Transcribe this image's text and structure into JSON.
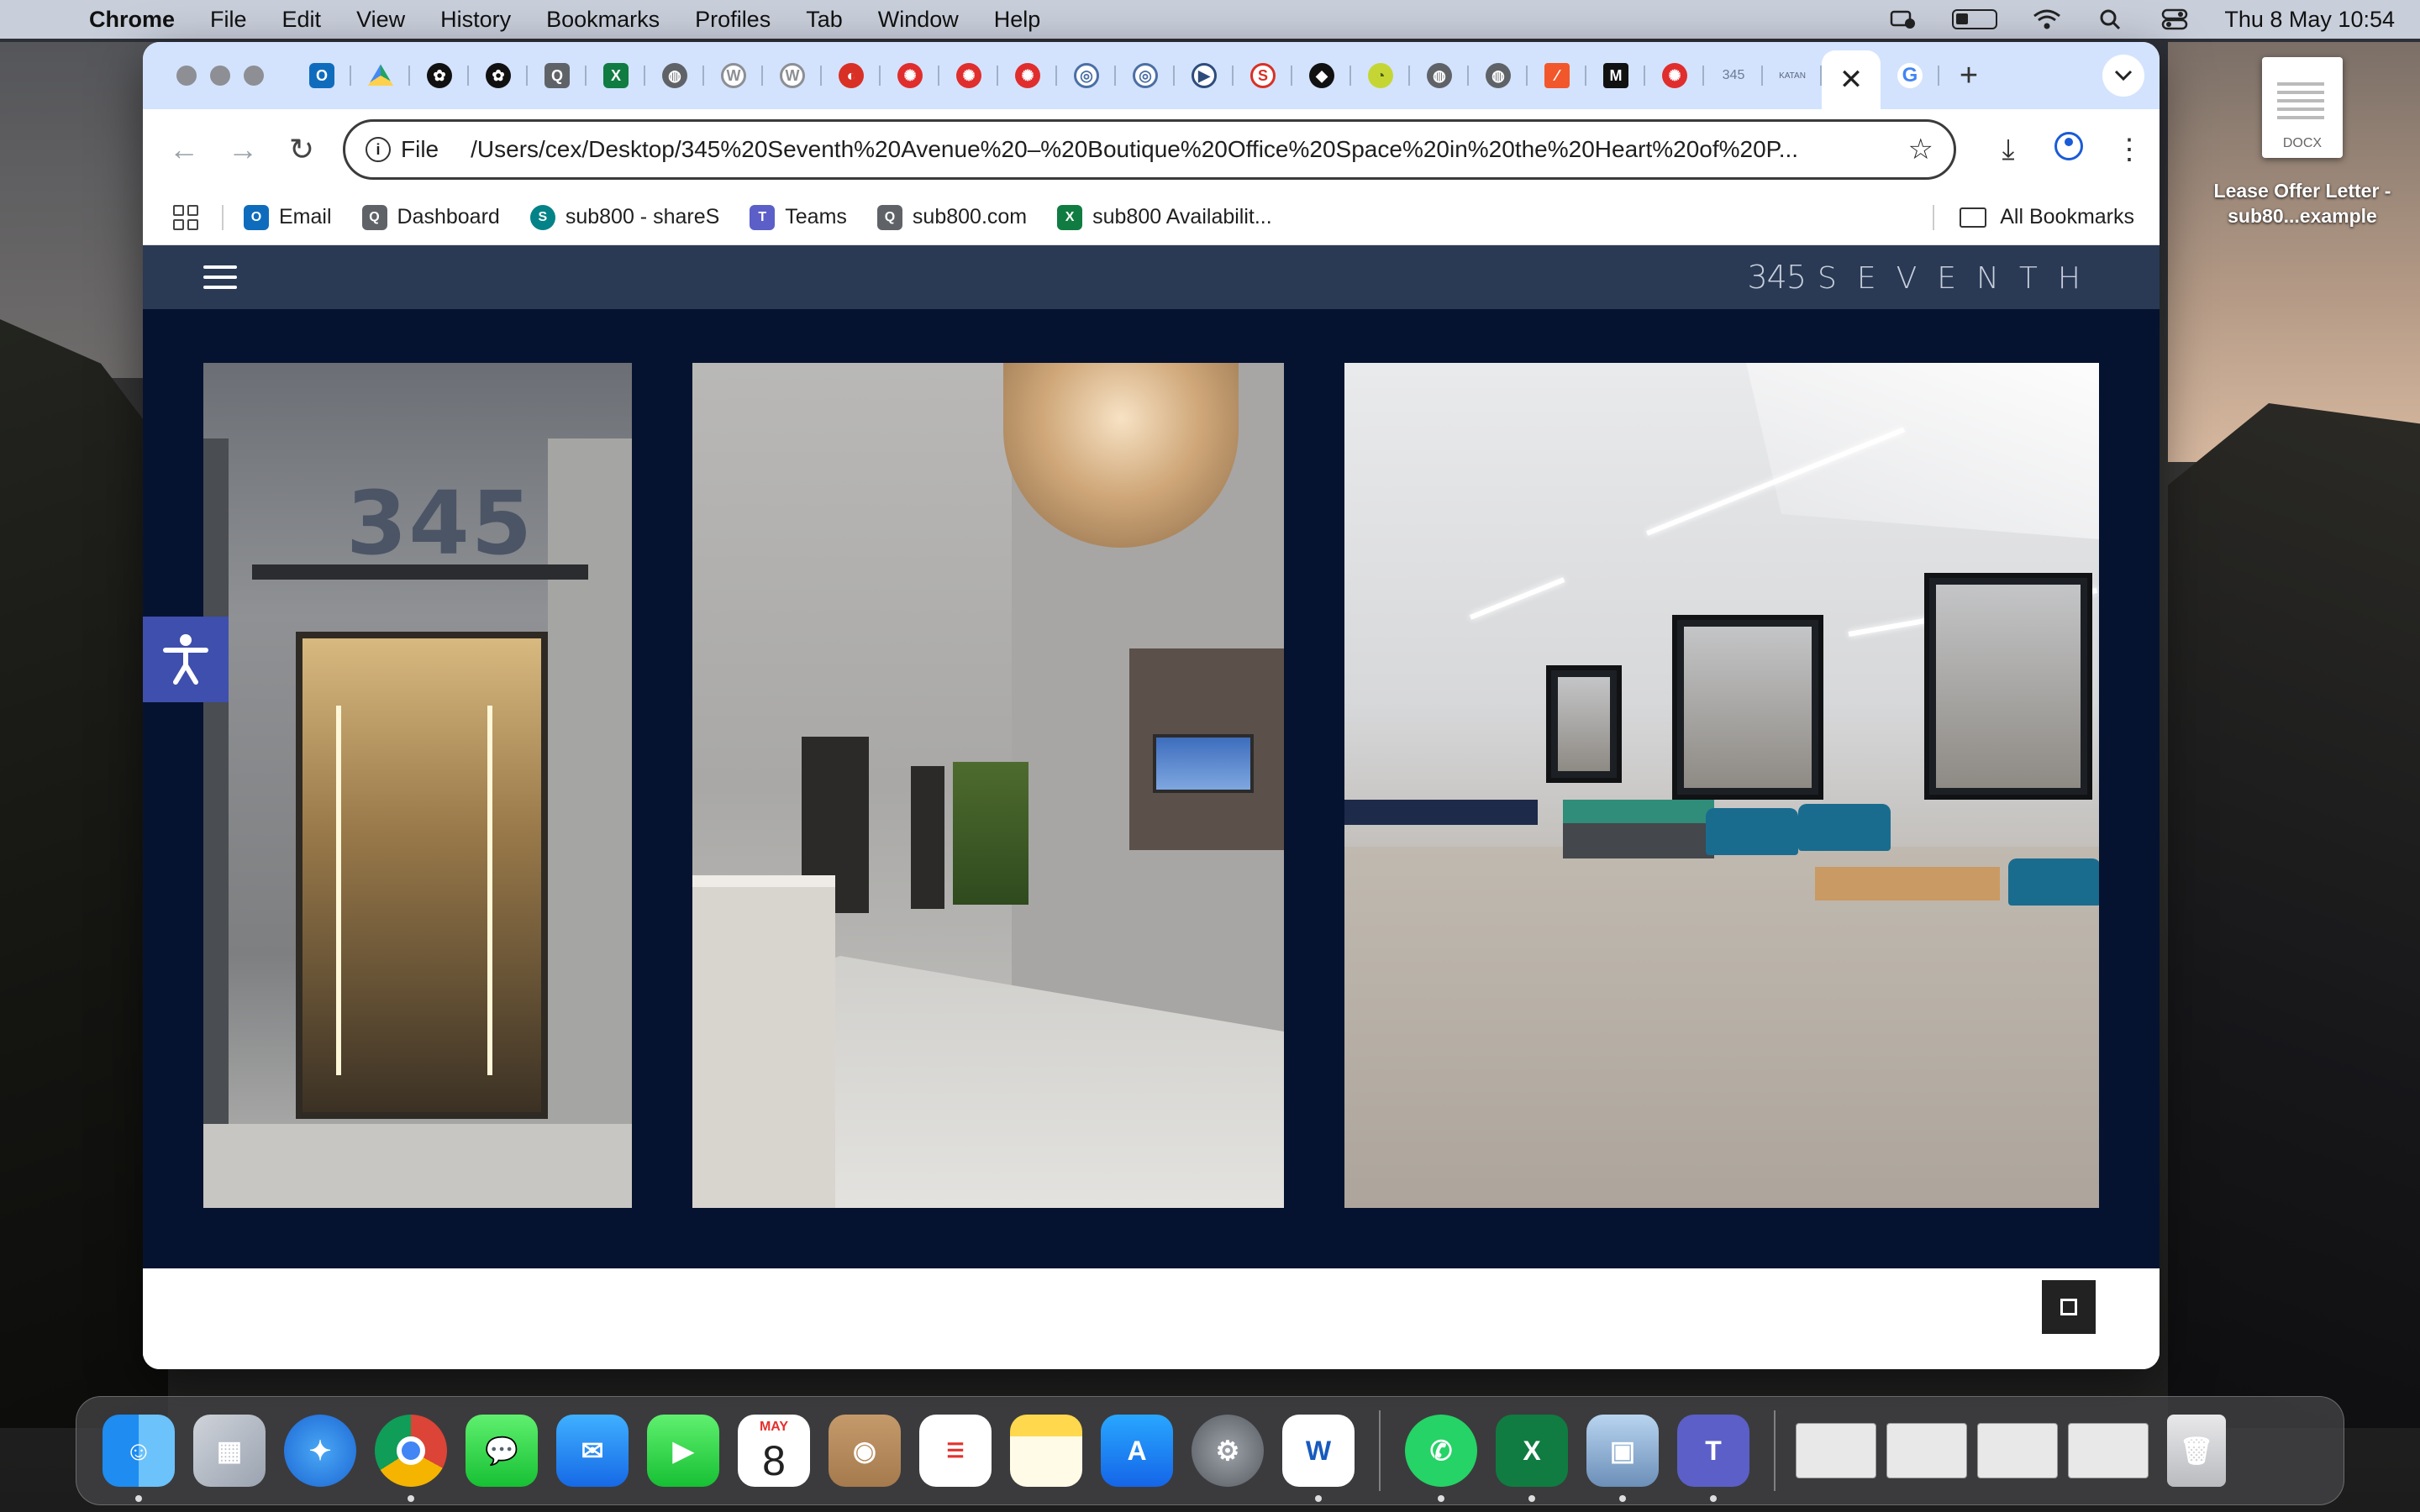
{
  "menubar": {
    "app_name": "Chrome",
    "menus": [
      "File",
      "Edit",
      "View",
      "History",
      "Bookmarks",
      "Profiles",
      "Tab",
      "Window",
      "Help"
    ],
    "datetime": "Thu 8 May  10:54"
  },
  "browser": {
    "active_tab_close": "✕",
    "new_tab": "+",
    "url_scheme": "File",
    "url": "/Users/cex/Desktop/345%20Seventh%20Avenue%20–%20Boutique%20Office%20Space%20in%20the%20Heart%20of%20P...",
    "bookmarks": [
      {
        "label": "Email",
        "color": "#0f6cbd",
        "glyph": "O"
      },
      {
        "label": "Dashboard",
        "color": "#5f6368",
        "glyph": "Q"
      },
      {
        "label": "sub800 - shareS",
        "color": "#038387",
        "glyph": "S"
      },
      {
        "label": "Teams",
        "color": "#5b5fc7",
        "glyph": "T"
      },
      {
        "label": "sub800.com",
        "color": "#5f6368",
        "glyph": "Q"
      },
      {
        "label": "sub800 Availabilit...",
        "color": "#107c41",
        "glyph": "X"
      }
    ],
    "all_bookmarks": "All Bookmarks"
  },
  "site": {
    "logo_number": "345",
    "logo_word": "SEVENTH",
    "photo1_sign": "345"
  },
  "desktop": {
    "file_ext": "DOCX",
    "file_label": "Lease Offer Letter - sub80...example"
  },
  "dock": {
    "calendar_month": "MAY",
    "calendar_day": "8"
  },
  "colors": {
    "site_header": "#2a3a55",
    "gallery_bg": "#061330",
    "accessibility": "#3f4fad"
  }
}
